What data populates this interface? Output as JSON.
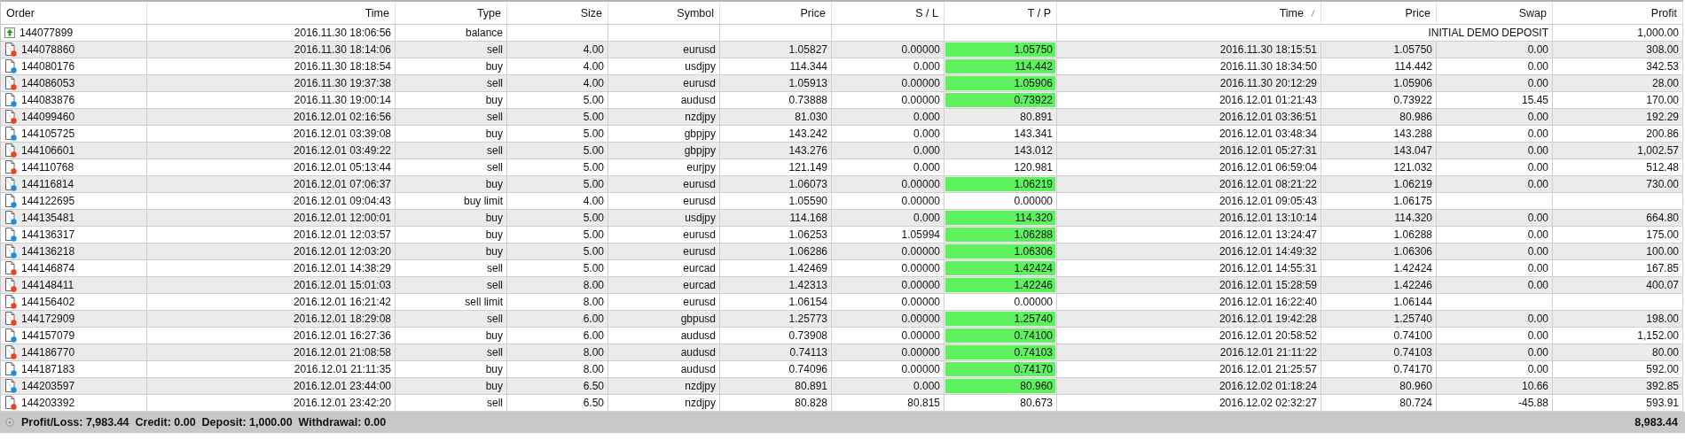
{
  "columns": [
    {
      "label": "Order",
      "sorted": false
    },
    {
      "label": "Time",
      "sorted": false
    },
    {
      "label": "Type",
      "sorted": false
    },
    {
      "label": "Size",
      "sorted": false
    },
    {
      "label": "Symbol",
      "sorted": false
    },
    {
      "label": "Price",
      "sorted": false
    },
    {
      "label": "S / L",
      "sorted": false
    },
    {
      "label": "T / P",
      "sorted": false
    },
    {
      "label": "Time",
      "sorted": true
    },
    {
      "label": "Price",
      "sorted": false
    },
    {
      "label": "Swap",
      "sorted": false
    },
    {
      "label": "Profit",
      "sorted": false
    }
  ],
  "rows": [
    {
      "kind": "balance",
      "order": "144077899",
      "time": "2016.11.30 18:06:56",
      "type": "balance",
      "comment": "INITIAL DEMO DEPOSIT",
      "profit": "1,000.00"
    },
    {
      "kind": "sell",
      "order": "144078860",
      "time": "2016.11.30 18:14:06",
      "type": "sell",
      "size": "4.00",
      "symbol": "eurusd",
      "price": "1.05827",
      "sl": "0.00000",
      "tp": "1.05750",
      "tp_hit": true,
      "close_time": "2016.11.30 18:15:51",
      "close_price": "1.05750",
      "swap": "0.00",
      "profit": "308.00"
    },
    {
      "kind": "buy",
      "order": "144080176",
      "time": "2016.11.30 18:18:54",
      "type": "buy",
      "size": "4.00",
      "symbol": "usdjpy",
      "price": "114.344",
      "sl": "0.000",
      "tp": "114.442",
      "tp_hit": true,
      "close_time": "2016.11.30 18:34:50",
      "close_price": "114.442",
      "swap": "0.00",
      "profit": "342.53"
    },
    {
      "kind": "sell",
      "order": "144086053",
      "time": "2016.11.30 19:37:38",
      "type": "sell",
      "size": "4.00",
      "symbol": "eurusd",
      "price": "1.05913",
      "sl": "0.00000",
      "tp": "1.05906",
      "tp_hit": true,
      "close_time": "2016.11.30 20:12:29",
      "close_price": "1.05906",
      "swap": "0.00",
      "profit": "28.00"
    },
    {
      "kind": "buy",
      "order": "144083876",
      "time": "2016.11.30 19:00:14",
      "type": "buy",
      "size": "5.00",
      "symbol": "audusd",
      "price": "0.73888",
      "sl": "0.00000",
      "tp": "0.73922",
      "tp_hit": true,
      "close_time": "2016.12.01 01:21:43",
      "close_price": "0.73922",
      "swap": "15.45",
      "profit": "170.00"
    },
    {
      "kind": "sell",
      "order": "144099460",
      "time": "2016.12.01 02:16:56",
      "type": "sell",
      "size": "5.00",
      "symbol": "nzdjpy",
      "price": "81.030",
      "sl": "0.000",
      "tp": "80.891",
      "tp_hit": false,
      "close_time": "2016.12.01 03:36:51",
      "close_price": "80.986",
      "swap": "0.00",
      "profit": "192.29"
    },
    {
      "kind": "buy",
      "order": "144105725",
      "time": "2016.12.01 03:39:08",
      "type": "buy",
      "size": "5.00",
      "symbol": "gbpjpy",
      "price": "143.242",
      "sl": "0.000",
      "tp": "143.341",
      "tp_hit": false,
      "close_time": "2016.12.01 03:48:34",
      "close_price": "143.288",
      "swap": "0.00",
      "profit": "200.86"
    },
    {
      "kind": "sell",
      "order": "144106601",
      "time": "2016.12.01 03:49:22",
      "type": "sell",
      "size": "5.00",
      "symbol": "gbpjpy",
      "price": "143.276",
      "sl": "0.000",
      "tp": "143.012",
      "tp_hit": false,
      "close_time": "2016.12.01 05:27:31",
      "close_price": "143.047",
      "swap": "0.00",
      "profit": "1,002.57"
    },
    {
      "kind": "sell",
      "order": "144110768",
      "time": "2016.12.01 05:13:44",
      "type": "sell",
      "size": "5.00",
      "symbol": "eurjpy",
      "price": "121.149",
      "sl": "0.000",
      "tp": "120.981",
      "tp_hit": false,
      "close_time": "2016.12.01 06:59:04",
      "close_price": "121.032",
      "swap": "0.00",
      "profit": "512.48"
    },
    {
      "kind": "buy",
      "order": "144116814",
      "time": "2016.12.01 07:06:37",
      "type": "buy",
      "size": "5.00",
      "symbol": "eurusd",
      "price": "1.06073",
      "sl": "0.00000",
      "tp": "1.06219",
      "tp_hit": true,
      "close_time": "2016.12.01 08:21:22",
      "close_price": "1.06219",
      "swap": "0.00",
      "profit": "730.00"
    },
    {
      "kind": "buy",
      "order": "144122695",
      "time": "2016.12.01 09:04:43",
      "type": "buy limit",
      "size": "4.00",
      "symbol": "eurusd",
      "price": "1.05590",
      "sl": "0.00000",
      "tp": "0.00000",
      "tp_hit": false,
      "close_time": "2016.12.01 09:05:43",
      "close_price": "1.06175"
    },
    {
      "kind": "buy",
      "order": "144135481",
      "time": "2016.12.01 12:00:01",
      "type": "buy",
      "size": "5.00",
      "symbol": "usdjpy",
      "price": "114.168",
      "sl": "0.000",
      "tp": "114.320",
      "tp_hit": true,
      "close_time": "2016.12.01 13:10:14",
      "close_price": "114.320",
      "swap": "0.00",
      "profit": "664.80"
    },
    {
      "kind": "buy",
      "order": "144136317",
      "time": "2016.12.01 12:03:57",
      "type": "buy",
      "size": "5.00",
      "symbol": "eurusd",
      "price": "1.06253",
      "sl": "1.05994",
      "tp": "1.06288",
      "tp_hit": true,
      "close_time": "2016.12.01 13:24:47",
      "close_price": "1.06288",
      "swap": "0.00",
      "profit": "175.00"
    },
    {
      "kind": "buy",
      "order": "144136218",
      "time": "2016.12.01 12:03:20",
      "type": "buy",
      "size": "5.00",
      "symbol": "eurusd",
      "price": "1.06286",
      "sl": "0.00000",
      "tp": "1.06306",
      "tp_hit": true,
      "close_time": "2016.12.01 14:49:32",
      "close_price": "1.06306",
      "swap": "0.00",
      "profit": "100.00"
    },
    {
      "kind": "sell",
      "order": "144146874",
      "time": "2016.12.01 14:38:29",
      "type": "sell",
      "size": "5.00",
      "symbol": "eurcad",
      "price": "1.42469",
      "sl": "0.00000",
      "tp": "1.42424",
      "tp_hit": true,
      "close_time": "2016.12.01 14:55:31",
      "close_price": "1.42424",
      "swap": "0.00",
      "profit": "167.85"
    },
    {
      "kind": "sell",
      "order": "144148411",
      "time": "2016.12.01 15:01:03",
      "type": "sell",
      "size": "8.00",
      "symbol": "eurcad",
      "price": "1.42313",
      "sl": "0.00000",
      "tp": "1.42246",
      "tp_hit": true,
      "close_time": "2016.12.01 15:28:59",
      "close_price": "1.42246",
      "swap": "0.00",
      "profit": "400.07"
    },
    {
      "kind": "sell",
      "order": "144156402",
      "time": "2016.12.01 16:21:42",
      "type": "sell limit",
      "size": "8.00",
      "symbol": "eurusd",
      "price": "1.06154",
      "sl": "0.00000",
      "tp": "0.00000",
      "tp_hit": false,
      "close_time": "2016.12.01 16:22:40",
      "close_price": "1.06144"
    },
    {
      "kind": "sell",
      "order": "144172909",
      "time": "2016.12.01 18:29:08",
      "type": "sell",
      "size": "6.00",
      "symbol": "gbpusd",
      "price": "1.25773",
      "sl": "0.00000",
      "tp": "1.25740",
      "tp_hit": true,
      "close_time": "2016.12.01 19:42:28",
      "close_price": "1.25740",
      "swap": "0.00",
      "profit": "198.00"
    },
    {
      "kind": "buy",
      "order": "144157079",
      "time": "2016.12.01 16:27:36",
      "type": "buy",
      "size": "6.00",
      "symbol": "audusd",
      "price": "0.73908",
      "sl": "0.00000",
      "tp": "0.74100",
      "tp_hit": true,
      "close_time": "2016.12.01 20:58:52",
      "close_price": "0.74100",
      "swap": "0.00",
      "profit": "1,152.00"
    },
    {
      "kind": "sell",
      "order": "144186770",
      "time": "2016.12.01 21:08:58",
      "type": "sell",
      "size": "8.00",
      "symbol": "audusd",
      "price": "0.74113",
      "sl": "0.00000",
      "tp": "0.74103",
      "tp_hit": true,
      "close_time": "2016.12.01 21:11:22",
      "close_price": "0.74103",
      "swap": "0.00",
      "profit": "80.00"
    },
    {
      "kind": "buy",
      "order": "144187183",
      "time": "2016.12.01 21:11:35",
      "type": "buy",
      "size": "8.00",
      "symbol": "audusd",
      "price": "0.74096",
      "sl": "0.00000",
      "tp": "0.74170",
      "tp_hit": true,
      "close_time": "2016.12.01 21:25:57",
      "close_price": "0.74170",
      "swap": "0.00",
      "profit": "592.00"
    },
    {
      "kind": "buy",
      "order": "144203597",
      "time": "2016.12.01 23:44:00",
      "type": "buy",
      "size": "6.50",
      "symbol": "nzdjpy",
      "price": "80.891",
      "sl": "0.000",
      "tp": "80.960",
      "tp_hit": true,
      "close_time": "2016.12.02 01:18:24",
      "close_price": "80.960",
      "swap": "10.66",
      "profit": "392.85"
    },
    {
      "kind": "sell",
      "order": "144203392",
      "time": "2016.12.01 23:42:20",
      "type": "sell",
      "size": "6.50",
      "symbol": "nzdjpy",
      "price": "80.828",
      "sl": "80.815",
      "tp": "80.673",
      "tp_hit": false,
      "close_time": "2016.12.02 02:32:27",
      "close_price": "80.724",
      "swap": "-45.88",
      "profit": "593.91"
    }
  ],
  "summary": {
    "text": "Profit/Loss: 7,983.44  Credit: 0.00  Deposit: 1,000.00  Withdrawal: 0.00",
    "total": "8,983.44"
  }
}
